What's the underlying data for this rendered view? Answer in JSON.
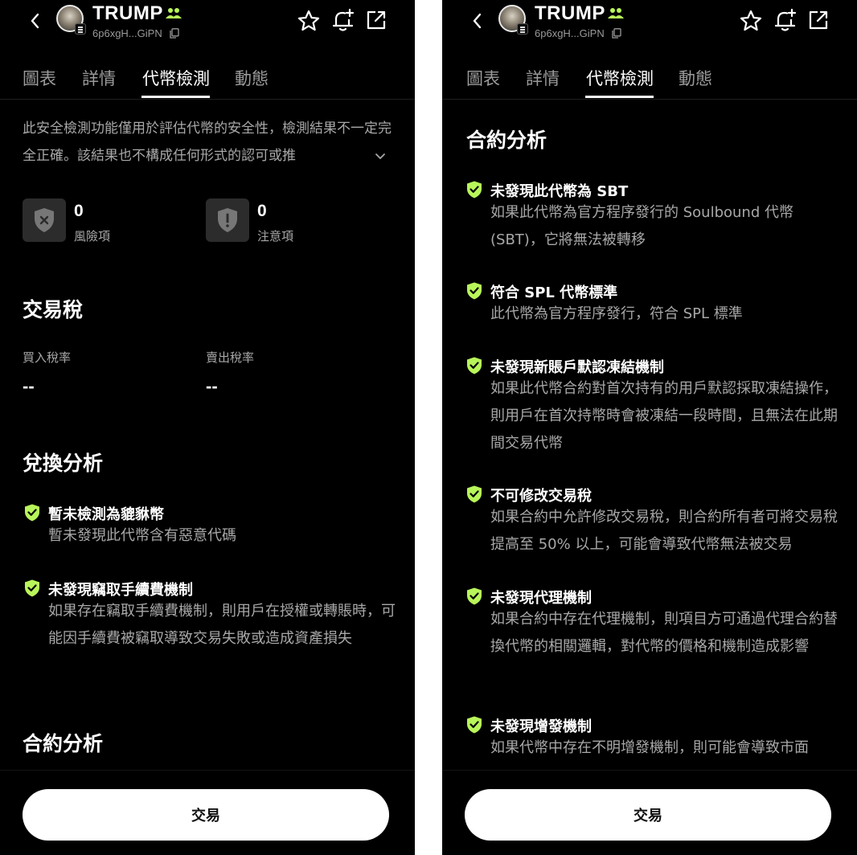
{
  "colors": {
    "background": "#000000",
    "accent_green": "#b8f55a",
    "muted_text": "#a8a8a8"
  },
  "header": {
    "token_name": "TRUMP",
    "token_address": "6p6xgH...GiPN",
    "icons": [
      "back-icon",
      "community-icon",
      "copy-icon",
      "star-icon",
      "bell-plus-icon",
      "share-icon"
    ]
  },
  "tabs": [
    {
      "label": "圖表"
    },
    {
      "label": "詳情"
    },
    {
      "label": "代幣檢測",
      "active": true
    },
    {
      "label": "動態"
    }
  ],
  "left": {
    "disclaimer": "此安全檢測功能僅用於評估代幣的安全性，檢測結果不一定完全正確。該結果也不構成任何形式的認可或推",
    "risk": {
      "value": "0",
      "label": "風險項"
    },
    "caution": {
      "value": "0",
      "label": "注意項"
    },
    "tax": {
      "title": "交易稅",
      "buy_label": "買入稅率",
      "buy_value": "--",
      "sell_label": "賣出稅率",
      "sell_value": "--"
    },
    "swap": {
      "title": "兌換分析",
      "items": [
        {
          "title": "暫未檢測為貔貅幣",
          "desc": "暫未發現此代幣含有惡意代碼"
        },
        {
          "title": "未發現竊取手續費機制",
          "desc": "如果存在竊取手續費機制，則用戶在授權或轉賬時，可能因手續費被竊取導致交易失敗或造成資產損失"
        }
      ]
    },
    "contract_title": "合約分析"
  },
  "right": {
    "contract_title": "合約分析",
    "items": [
      {
        "title": "未發現此代幣為 SBT",
        "desc": "如果此代幣為官方程序發行的 Soulbound 代幣 (SBT)，它將無法被轉移"
      },
      {
        "title": "符合 SPL 代幣標準",
        "desc": "此代幣為官方程序發行，符合 SPL 標準"
      },
      {
        "title": "未發現新賬戶默認凍結機制",
        "desc": "如果此代幣合約對首次持有的用戶默認採取凍結操作，則用戶在首次持幣時會被凍結一段時間，且無法在此期間交易代幣"
      },
      {
        "title": "不可修改交易稅",
        "desc": "如果合約中允許修改交易稅，則合約所有者可將交易稅提高至 50% 以上，可能會導致代幣無法被交易"
      },
      {
        "title": "未發現代理機制",
        "desc": "如果合約中存在代理機制，則項目方可通過代理合約替換代幣的相關邏輯，對代幣的價格和機制造成影響"
      },
      {
        "title": "未發現增發機制",
        "desc": "如果代幣中存在不明增發機制，則可能會導致市面"
      }
    ]
  },
  "trade_button": "交易"
}
